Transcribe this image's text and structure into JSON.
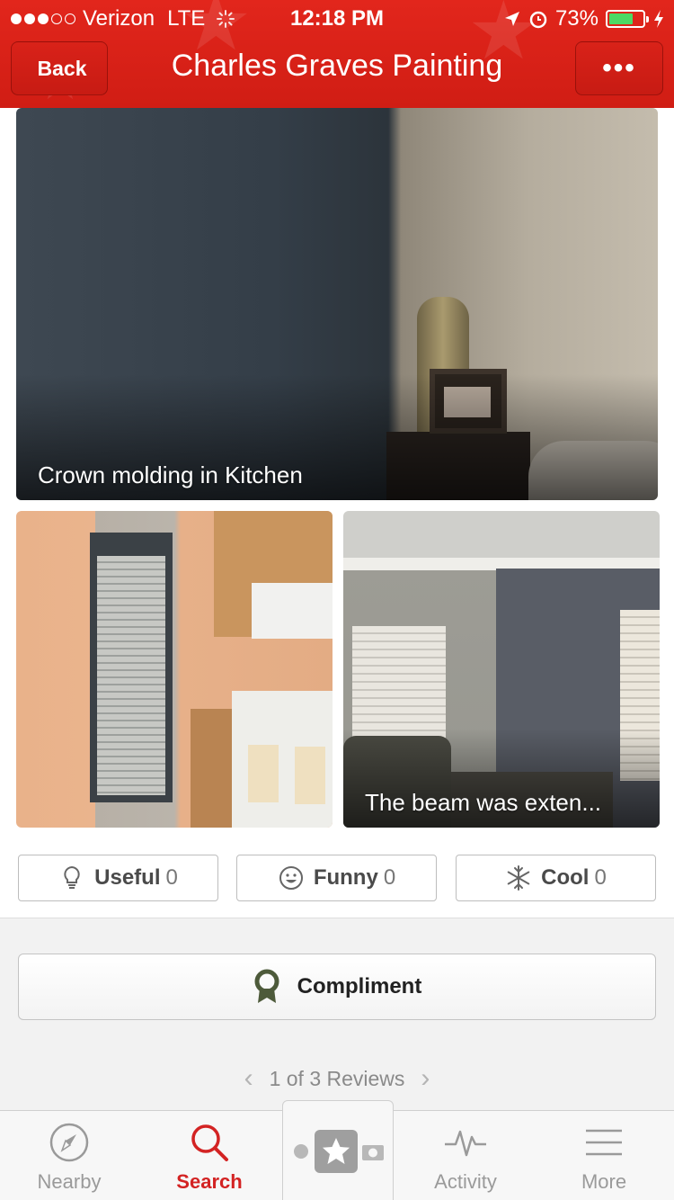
{
  "status_bar": {
    "carrier": "Verizon",
    "network": "LTE",
    "time": "12:18 PM",
    "battery": "73%",
    "battery_level": 0.73
  },
  "header": {
    "back_label": "Back",
    "title": "Charles Graves Painting",
    "more_label": "•••"
  },
  "photos": {
    "main_caption": "Crown molding in Kitchen",
    "right_caption": "The beam was exten..."
  },
  "reactions": [
    {
      "label": "Useful",
      "count": "0",
      "icon": "lightbulb-icon"
    },
    {
      "label": "Funny",
      "count": "0",
      "icon": "smiley-icon"
    },
    {
      "label": "Cool",
      "count": "0",
      "icon": "snowflake-icon"
    }
  ],
  "compliment": {
    "label": "Compliment",
    "icon": "ribbon-icon"
  },
  "pager": {
    "text": "1 of 3 Reviews"
  },
  "tabs": [
    {
      "label": "Nearby",
      "icon": "compass-icon"
    },
    {
      "label": "Search",
      "icon": "search-icon"
    },
    {
      "label": "Activity",
      "icon": "activity-icon"
    },
    {
      "label": "More",
      "icon": "menu-icon"
    }
  ],
  "colors": {
    "brand_red": "#d32323",
    "battery_green": "#4cd964"
  }
}
